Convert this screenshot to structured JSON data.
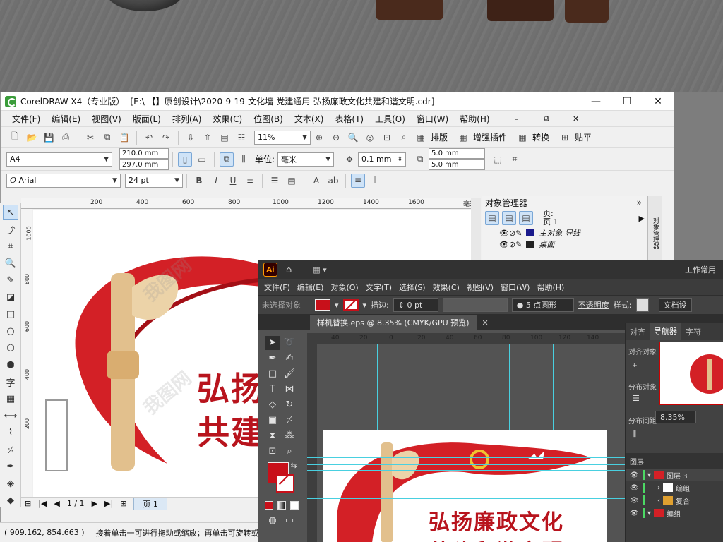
{
  "corel": {
    "title": "CorelDRAW X4（专业版）- [E:\\ 【】原创设计\\2020-9-19-文化墙-党建通用-弘扬廉政文化共建和谐文明.cdr]",
    "menu": [
      "文件(F)",
      "编辑(E)",
      "视图(V)",
      "版面(L)",
      "排列(A)",
      "效果(C)",
      "位图(B)",
      "文本(X)",
      "表格(T)",
      "工具(O)",
      "窗口(W)",
      "帮助(H)"
    ],
    "zoom": "11%",
    "toolbar_buttons": [
      "排版",
      "增强插件",
      "转换",
      "贴平"
    ],
    "page_size": "A4",
    "width": "210.0 mm",
    "height": "297.0 mm",
    "unit_label": "单位:",
    "unit_value": "毫米",
    "nudge": "0.1 mm",
    "dup_x": "5.0 mm",
    "dup_y": "5.0 mm",
    "font_name": "Arial",
    "font_size": "24 pt",
    "ruler_ticks": [
      "200",
      "400",
      "600",
      "800",
      "1000",
      "1200",
      "1400",
      "1600"
    ],
    "ruler_unit": "毫米",
    "vruler_ticks": [
      "1000",
      "800",
      "600",
      "400",
      "200"
    ],
    "page_counter": "1 / 1",
    "page_tab": "页 1",
    "status_coords": "( 909.162, 854.663 )",
    "status_hint": "接着单击一可进行拖动或缩放；再单击可旋转或倾斜",
    "obj_manager": {
      "title": "对象管理器",
      "page_label": "页:",
      "page_name": "页 1",
      "layers": [
        "主对象 导线",
        "桌面"
      ],
      "side_label": "对象管理器"
    },
    "canvas_text_1": "弘扬",
    "canvas_text_2": "共建"
  },
  "ai": {
    "logo": "Ai",
    "workspace": "工作常用",
    "menu": [
      "文件(F)",
      "编辑(E)",
      "对象(O)",
      "文字(T)",
      "选择(S)",
      "效果(C)",
      "视图(V)",
      "窗口(W)",
      "帮助(H)"
    ],
    "no_selection": "未选择对象",
    "stroke_label": "描边:",
    "stroke_value": "0 pt",
    "brush": "5 点圆形",
    "opacity": "不透明度",
    "style": "样式:",
    "doc_btn": "文档设",
    "doc_tab": "样机替换.eps @ 8.35% (CMYK/GPU 预览)",
    "ruler_ticks": [
      "40",
      "20",
      "0",
      "20",
      "40",
      "60",
      "80",
      "100",
      "120",
      "140"
    ],
    "panel_tabs": [
      "对齐",
      "导航器",
      "字符"
    ],
    "align_labels": [
      "对齐对象",
      "分布对象",
      "分布间距"
    ],
    "nav_zoom": "8.35%",
    "layers_title": "图层",
    "layers": [
      "图层 3",
      "编组",
      "复合",
      "编组"
    ],
    "slogan_1": "弘扬廉政文化",
    "slogan_2": "共建和谐文明"
  },
  "colors": {
    "accent_red": "#c8101a",
    "ai_bg": "#535353",
    "gold": "#e2c08d"
  }
}
